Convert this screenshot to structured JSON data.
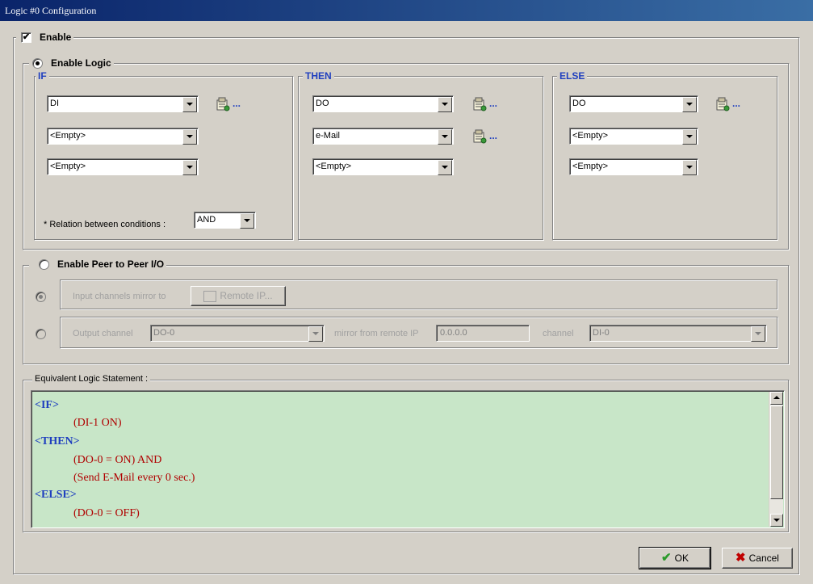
{
  "window": {
    "title": "Logic #0 Configuration"
  },
  "enable": {
    "label": "Enable",
    "checked": true,
    "mark": "✔"
  },
  "logic": {
    "label": "Enable Logic",
    "if": {
      "label": "IF",
      "selects": [
        "DI",
        "<Empty>",
        "<Empty>"
      ],
      "relation_label": "* Relation between conditions :",
      "relation_value": "AND"
    },
    "then": {
      "label": "THEN",
      "selects": [
        "DO",
        "e-Mail",
        "<Empty>"
      ]
    },
    "else": {
      "label": "ELSE",
      "selects": [
        "DO",
        "<Empty>",
        "<Empty>"
      ]
    },
    "config_dots": "..."
  },
  "peer": {
    "label": "Enable Peer to Peer I/O",
    "input_label": "Input channels mirror to",
    "remote_ip_button": "Remote IP...",
    "output_label": "Output channel",
    "output_value": "DO-0",
    "mirror_label": "mirror from remote IP",
    "mirror_ip": "0.0.0.0",
    "channel_label": "channel",
    "channel_value": "DI-0"
  },
  "statement": {
    "label": "Equivalent Logic Statement :",
    "lines": [
      "<IF>",
      "(DI-1 ON)",
      "<THEN>",
      "(DO-0 = ON)  AND",
      "(Send E-Mail every 0 sec.)",
      "<ELSE>",
      "(DO-0 = OFF)"
    ]
  },
  "buttons": {
    "ok": "OK",
    "cancel": "Cancel"
  },
  "colors": {
    "title_bar": "#0a246a",
    "blue_label": "#1f3fbf",
    "statement_bg": "#c8e6c8",
    "expression": "#b00000"
  }
}
